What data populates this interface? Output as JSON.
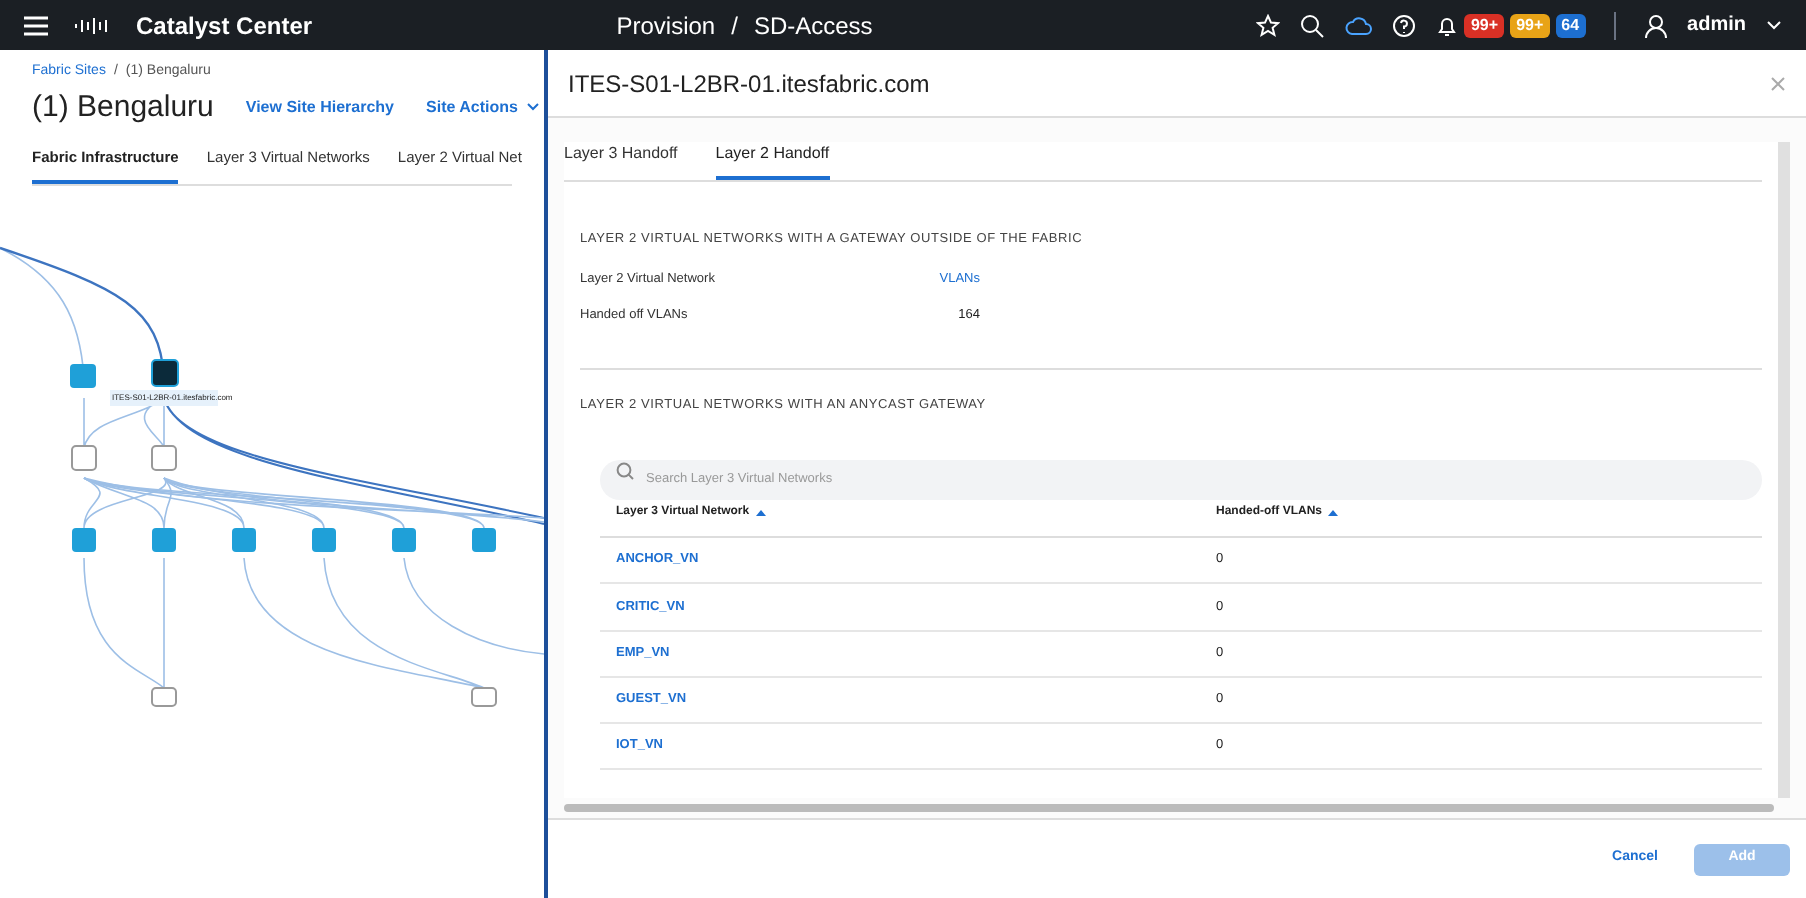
{
  "header": {
    "product": "Catalyst Center",
    "breadcrumb": [
      "Provision",
      "SD-Access"
    ],
    "separator": "/",
    "badges": [
      {
        "text": "99+",
        "color": "#d93025"
      },
      {
        "text": "99+",
        "color": "#e8a317"
      },
      {
        "text": "64",
        "color": "#1d6fd1"
      }
    ],
    "user": "admin"
  },
  "page": {
    "breadcrumb": [
      "Fabric Sites",
      "(1) Bengaluru"
    ],
    "separator": "/",
    "title": "(1) Bengaluru",
    "links": [
      "View Site Hierarchy",
      "Site Actions"
    ],
    "tabs": [
      {
        "label": "Fabric Infrastructure",
        "selected": true
      },
      {
        "label": "Layer 3 Virtual Networks",
        "selected": false
      },
      {
        "label": "Layer 2 Virtual Net",
        "selected": false
      }
    ],
    "topology": {
      "selected_node_label": "ITES-S01-L2BR-01.itesfabric.com"
    }
  },
  "panel": {
    "title": "ITES-S01-L2BR-01.itesfabric.com",
    "tabs": [
      {
        "label": "Layer 3 Handoff",
        "selected": false
      },
      {
        "label": "Layer 2 Handoff",
        "selected": true
      }
    ],
    "section1": {
      "heading": "LAYER 2 VIRTUAL NETWORKS WITH A GATEWAY OUTSIDE OF THE FABRIC",
      "rows": [
        {
          "label": "Layer 2 Virtual Network",
          "value": "VLANs",
          "kind": "link"
        },
        {
          "label": "Handed off VLANs",
          "value": "164",
          "kind": "text"
        }
      ]
    },
    "section2": {
      "heading": "LAYER 2 VIRTUAL NETWORKS WITH AN ANYCAST GATEWAY",
      "search": {
        "placeholder": "Search Layer 3 Virtual Networks"
      },
      "columns": [
        "Layer 3 Virtual Network",
        "Handed-off VLANs"
      ],
      "rows": [
        {
          "network": "ANCHOR_VN",
          "vlans": "0"
        },
        {
          "network": "CRITIC_VN",
          "vlans": "0"
        },
        {
          "network": "EMP_VN",
          "vlans": "0"
        },
        {
          "network": "GUEST_VN",
          "vlans": "0"
        },
        {
          "network": "IOT_VN",
          "vlans": "0"
        }
      ]
    },
    "buttons": [
      {
        "label": "Cancel",
        "kind": "link",
        "disabled": false
      },
      {
        "label": "Add",
        "kind": "primary",
        "disabled": true
      }
    ]
  }
}
